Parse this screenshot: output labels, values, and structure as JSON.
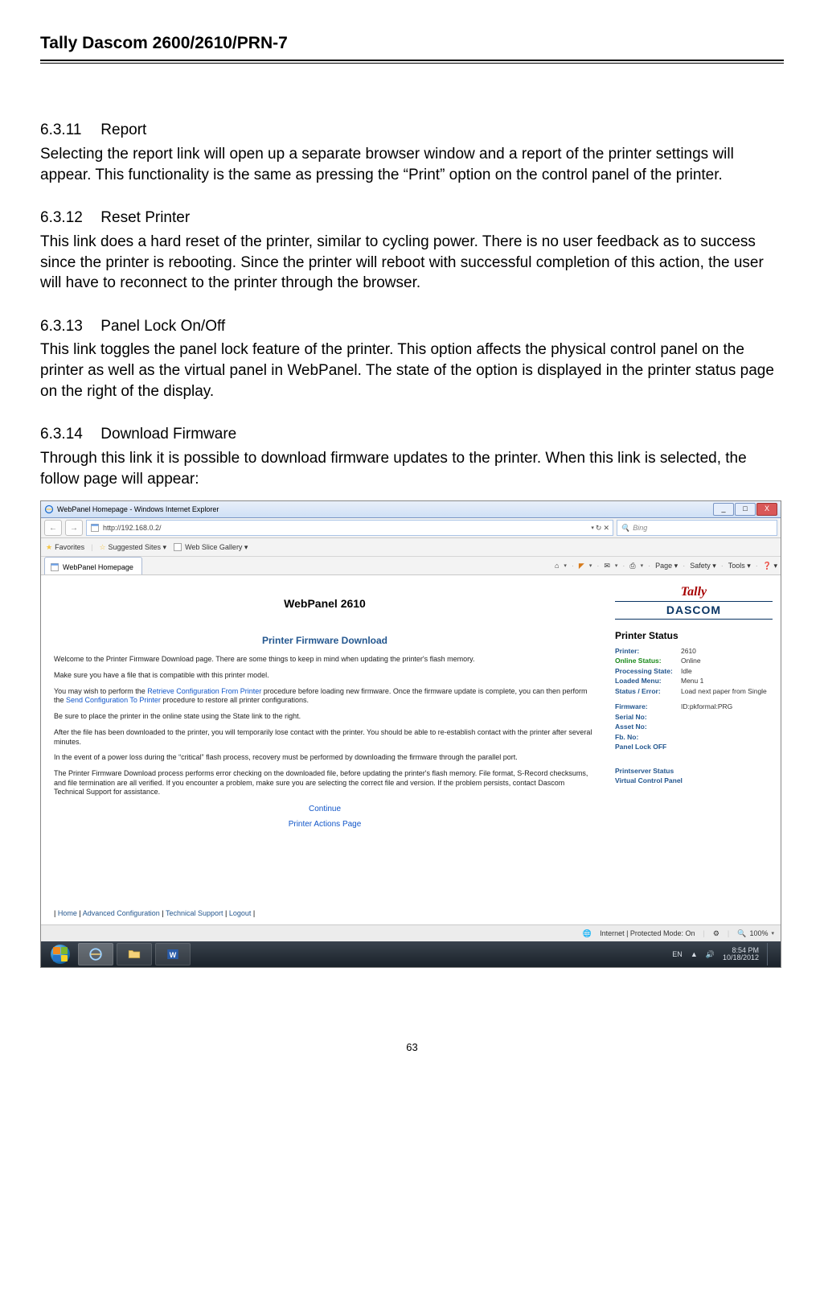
{
  "doc": {
    "header": "Tally Dascom 2600/2610/PRN-7",
    "page_number": "63"
  },
  "sections": {
    "s1_num": "6.3.11",
    "s1_title": "Report",
    "s1_body": "Selecting the report link will open up a separate browser window and a report of the printer settings will appear. This functionality is the same as pressing the “Print” option on the control panel of the printer.",
    "s2_num": "6.3.12",
    "s2_title": "Reset Printer",
    "s2_body": "This link does a hard reset of the printer, similar to cycling power. There is no user feedback as to success since the printer is rebooting. Since the printer will reboot with successful completion of this action, the user will have to reconnect to the printer through the browser.",
    "s3_num": "6.3.13",
    "s3_title": "Panel Lock On/Off",
    "s3_body": "This link toggles the panel lock feature of the printer. This option affects the physical control panel on the printer as well as the virtual panel in WebPanel. The state of the option is displayed in the printer status page on the right of the display.",
    "s4_num": "6.3.14",
    "s4_title": "Download Firmware",
    "s4_body": "Through this link it is possible to download firmware updates to the printer. When this link is selected, the follow page will appear:"
  },
  "screenshot": {
    "window_title": "WebPanel Homepage - Windows Internet Explorer",
    "win_min": "_",
    "win_max": "□",
    "win_close": "X",
    "nav_back": "←",
    "nav_fwd": "→",
    "url": "http://192.168.0.2/",
    "addr_refresh": "↻",
    "addr_stop": "✕",
    "search_placeholder": "Bing",
    "search_icon": "🔍",
    "fav_label": "Favorites",
    "fav_suggested": "Suggested Sites ▾",
    "fav_slice": "Web Slice Gallery ▾",
    "tab_label": "WebPanel Homepage",
    "tool_home": "⌂",
    "tool_feed": "◤",
    "tool_mail": "✉",
    "tool_print": "⎙",
    "tool_page": "Page ▾",
    "tool_safety": "Safety ▾",
    "tool_tools": "Tools ▾",
    "tool_help": "❓ ▾",
    "webpanel_title": "WebPanel 2610",
    "page_h2": "Printer Firmware Download",
    "p1": "Welcome to the Printer Firmware Download page. There are some things to keep in mind when updating the printer's flash memory.",
    "p2": "Make sure you have a file that is compatible with this printer model.",
    "p3a": "You may wish to perform the ",
    "p3_link1": "Retrieve Configuration From Printer",
    "p3b": " procedure before loading new firmware. Once the firmware update is complete, you can then perform the ",
    "p3_link2": "Send Configuration To Printer",
    "p3c": " procedure to restore all printer configurations.",
    "p4": "Be sure to place the printer in the online state using the State link to the right.",
    "p5": "After the file has been downloaded to the printer, you will temporarily lose contact with the printer. You should be able to re-establish contact with the printer after several minutes.",
    "p6": "In the event of a power loss during the “critical” flash process, recovery must be performed by downloading the firmware through the parallel port.",
    "p7": "The Printer Firmware Download process performs error checking on the downloaded file, before updating the printer's flash memory. File format, S-Record checksums, and file termination are all verified. If you encounter a problem, make sure you are selecting the correct file and version. If the problem persists, contact Dascom Technical Support for assistance.",
    "btn_continue": "Continue",
    "link_actions": "Printer Actions Page",
    "logo_top": "Tally",
    "logo_bottom": "DASCOM",
    "status_heading": "Printer Status",
    "status_printer_l": "Printer:",
    "status_printer_v": "2610",
    "status_online_l": "Online Status:",
    "status_online_v": "Online",
    "status_proc_l": "Processing State:",
    "status_proc_v": "Idle",
    "status_menu_l": "Loaded Menu:",
    "status_menu_v": "Menu 1",
    "status_error_l": "Status / Error:",
    "status_error_v": "Load next paper from Single",
    "status_fw_l": "Firmware:",
    "status_fw_v": "ID:pkformal:PRG",
    "status_serial_l": "Serial No:",
    "status_asset_l": "Asset No:",
    "status_fb_l": "Fb. No:",
    "status_lock_l": "Panel Lock OFF",
    "side_link1": "Printserver Status",
    "side_link2": "Virtual Control Panel",
    "footer_home": "Home",
    "footer_adv": "Advanced Configuration",
    "footer_tech": "Technical Support",
    "footer_logout": "Logout",
    "footer_sep": " | ",
    "statusbar_zone": "Internet | Protected Mode: On",
    "statusbar_zoom": "100%",
    "taskbar_lang": "EN",
    "taskbar_time": "8:54 PM",
    "taskbar_date": "10/18/2012"
  }
}
